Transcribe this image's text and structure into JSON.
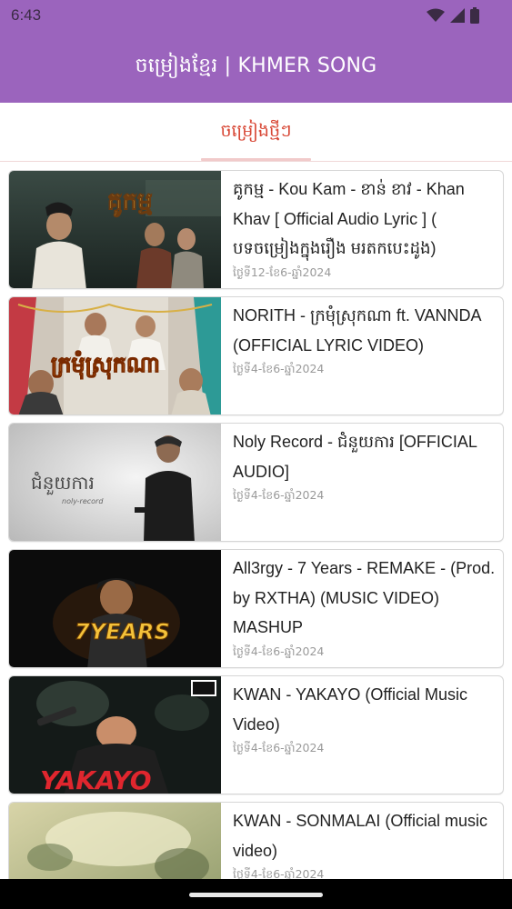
{
  "status": {
    "time": "6:43",
    "icons": [
      "wifi-icon",
      "signal-icon",
      "battery-icon"
    ]
  },
  "appbar": {
    "title": "ចម្រៀងខ្មែរ | KHMER SONG"
  },
  "tabs": [
    {
      "label": "ចម្រៀងថ្មីៗ",
      "selected": true
    }
  ],
  "colors": {
    "primary": "#9b64bd",
    "tab_active": "#d84836",
    "date": "#9a9a9a"
  },
  "songs": [
    {
      "title": "គូកម្ម - Kou Kam - ខាន់ ខាវ - Khan Khav [ Official Audio Lyric ] ( បទចម្រៀងក្នុងរឿង មរតកបេះដូង)",
      "date": "ថ្ងៃទី12-ខែ6-ឆ្នាំ2024",
      "thumb_text": "គូកម្ម"
    },
    {
      "title": "NORITH - ក្រមុំស្រុកណា ft. VANNDA (OFFICIAL LYRIC VIDEO)",
      "date": "ថ្ងៃទី4-ខែ6-ឆ្នាំ2024",
      "thumb_text": "ក្រមុំស្រុកណា"
    },
    {
      "title": "Noly Record - ជំនួយការ [OFFICIAL AUDIO]",
      "date": "ថ្ងៃទី4-ខែ6-ឆ្នាំ2024",
      "thumb_text": "ជំនួយការ",
      "thumb_sub": "noly-record"
    },
    {
      "title": "All3rgy - 7 Years - REMAKE - (Prod. by RXTHA) (MUSIC VIDEO) MASHUP",
      "date": "ថ្ងៃទី4-ខែ6-ឆ្នាំ2024",
      "thumb_text": "7YEARS"
    },
    {
      "title": "KWAN - YAKAYO (Official Music Video)",
      "date": "ថ្ងៃទី4-ខែ6-ឆ្នាំ2024",
      "thumb_text": "YAKAYO"
    },
    {
      "title": "KWAN - SONMALAI (Official music video)",
      "date": "ថ្ងៃទី4-ខែ6-ឆ្នាំ2024",
      "thumb_text": ""
    }
  ]
}
